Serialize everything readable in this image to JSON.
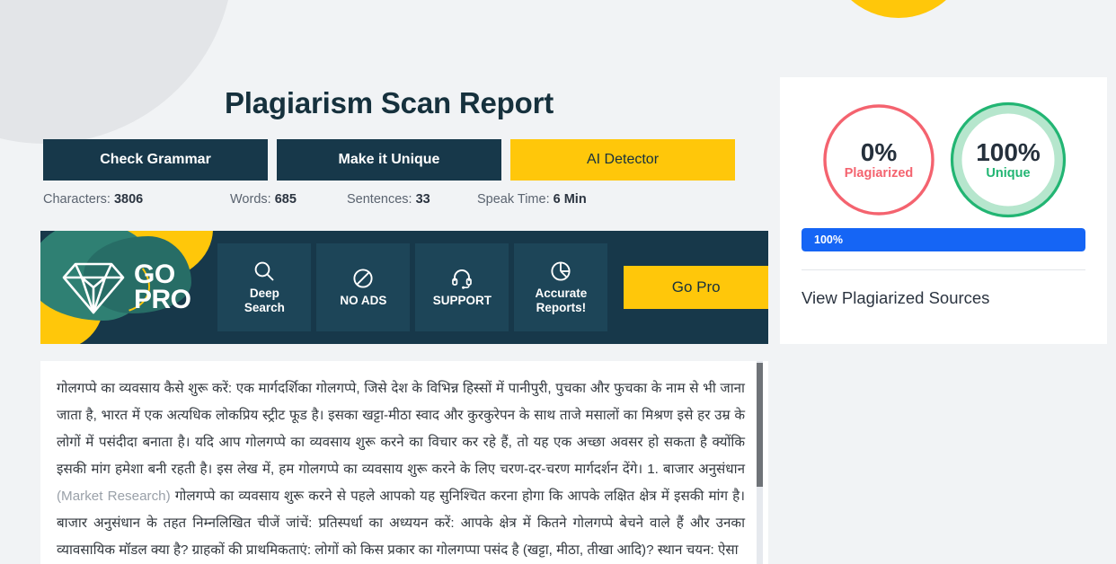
{
  "theme": {
    "navy": "#17384a",
    "yellow": "#ffc70a",
    "blue": "#1565f5",
    "red": "#f4636f",
    "green": "#22b573",
    "green_light": "#b6e6cd",
    "page_bg": "#f1f3f5"
  },
  "header": {
    "title": "Plagiarism Scan Report"
  },
  "actions": [
    {
      "label": "Check Grammar",
      "style": "navy",
      "icon": "none"
    },
    {
      "label": "Make it Unique",
      "style": "navy",
      "icon": "none"
    },
    {
      "label": "AI Detector",
      "style": "yellow",
      "icon": "none"
    }
  ],
  "stats": [
    {
      "label": "Characters:",
      "value": "3806"
    },
    {
      "label": "Words:",
      "value": "685"
    },
    {
      "label": "Sentences:",
      "value": "33"
    },
    {
      "label": "Speak Time:",
      "value": "6 Min"
    }
  ],
  "gopro": {
    "brand_line1": "GO",
    "brand_line2": "PRO",
    "diamond_icon": "diamond-icon",
    "features": [
      {
        "icon": "search-icon",
        "label": "Deep\nSearch",
        "label_line1": "Deep",
        "label_line2": "Search"
      },
      {
        "icon": "no-ads-icon",
        "label": "NO ADS",
        "label_line1": "NO ADS",
        "label_line2": ""
      },
      {
        "icon": "headset-icon",
        "label": "SUPPORT",
        "label_line1": "SUPPORT",
        "label_line2": ""
      },
      {
        "icon": "pie-chart-icon",
        "label": "Accurate\nReports!",
        "label_line1": "Accurate",
        "label_line2": "Reports!"
      }
    ],
    "cta_label": "Go Pro"
  },
  "document": {
    "paragraph_part1": "गोलगप्पे का व्यवसाय कैसे शुरू करें: एक मार्गदर्शिका गोलगप्पे, जिसे देश के विभिन्न हिस्सों में पानीपुरी, पुचका और फुचका के नाम से भी जाना जाता है, भारत में एक अत्यधिक लोकप्रिय स्ट्रीट फूड है। इसका खट्टा-मीठा स्वाद और कुरकुरेपन के साथ ताजे मसालों का मिश्रण इसे हर उम्र के लोगों में पसंदीदा बनाता है। यदि आप गोलगप्पे का व्यवसाय शुरू करने का विचार कर रहे हैं, तो यह एक अच्छा अवसर हो सकता है क्योंकि इसकी मांग हमेशा बनी रहती है। इस लेख में, हम गोलगप्पे का व्यवसाय शुरू करने के लिए चरण-दर-चरण मार्गदर्शन देंगे। 1. बाजार अनुसंधान ",
    "paragraph_muted": "(Market Research)",
    "paragraph_part2": " गोलगप्पे का व्यवसाय शुरू करने से पहले आपको यह सुनिश्चित करना होगा कि आपके लक्षित क्षेत्र में इसकी मांग है। बाजार अनुसंधान के तहत निम्नलिखित चीजें जांचें: प्रतिस्पर्धा का अध्ययन करें: आपके क्षेत्र में कितने गोलगप्पे बेचने वाले हैं और उनका व्यावसायिक मॉडल क्या है? ग्राहकों की प्राथमिकताएं: लोगों को किस प्रकार का गोलगप्पा पसंद है (खट्टा, मीठा, तीखा आदि)? स्थान चयन: ऐसा"
  },
  "results": {
    "plagiarized": {
      "percent": "0%",
      "label": "Plagiarized",
      "value": 0
    },
    "unique": {
      "percent": "100%",
      "label": "Unique",
      "value": 100
    },
    "progress": {
      "label": "100%",
      "value": 100
    },
    "view_sources_label": "View Plagiarized Sources"
  }
}
